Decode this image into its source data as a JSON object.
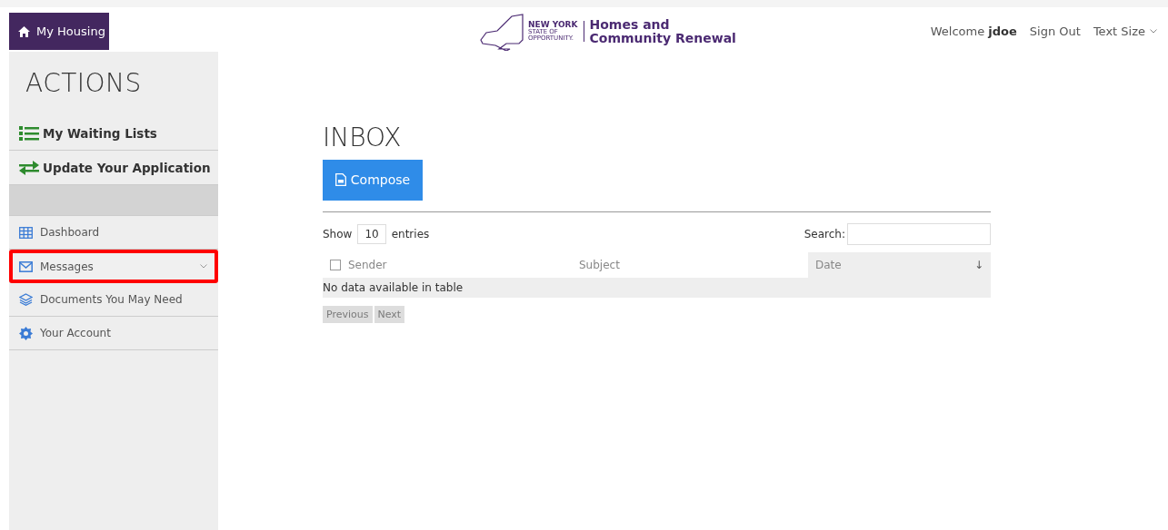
{
  "home_tab": {
    "label": "My Housing"
  },
  "header": {
    "logo": {
      "state_name": "NEW YORK",
      "state_tagline": [
        "STATE OF",
        "OPPORTUNITY."
      ],
      "agency": [
        "Homes and",
        "Community Renewal"
      ]
    },
    "welcome": {
      "prefix": "Welcome",
      "user": "jdoe"
    },
    "links": [
      {
        "label": "Sign Out",
        "dropdown": false
      },
      {
        "label": "Text Size",
        "dropdown": true
      }
    ]
  },
  "sidebar": {
    "title": "ACTIONS",
    "primary_items": [
      {
        "label": "My Waiting Lists",
        "kind": "list"
      },
      {
        "label": "Update Your Application",
        "kind": "swap"
      }
    ],
    "items": [
      {
        "label": "Dashboard",
        "kind": "grid",
        "expandable": false,
        "highlighted": false
      },
      {
        "label": "Messages",
        "kind": "mail",
        "expandable": true,
        "highlighted": true
      },
      {
        "label": "Documents You May Need",
        "kind": "layers",
        "expandable": false,
        "highlighted": false
      },
      {
        "label": "Your Account",
        "kind": "gear",
        "expandable": false,
        "highlighted": false
      }
    ]
  },
  "main": {
    "title": "INBOX",
    "compose_button": "Compose",
    "length": {
      "before": "Show",
      "value": "10",
      "after": "entries"
    },
    "search_label": "Search:",
    "table": {
      "select_all_checked": false,
      "columns": [
        {
          "label": "Sender",
          "sorted": false
        },
        {
          "label": "Subject",
          "sorted": false
        },
        {
          "label": "Date",
          "sorted": true,
          "sort_mark": "↓"
        }
      ],
      "empty_message": "No data available in table"
    },
    "pagination": [
      {
        "label": "Previous",
        "disabled": true
      },
      {
        "label": "Next",
        "disabled": true
      }
    ]
  }
}
